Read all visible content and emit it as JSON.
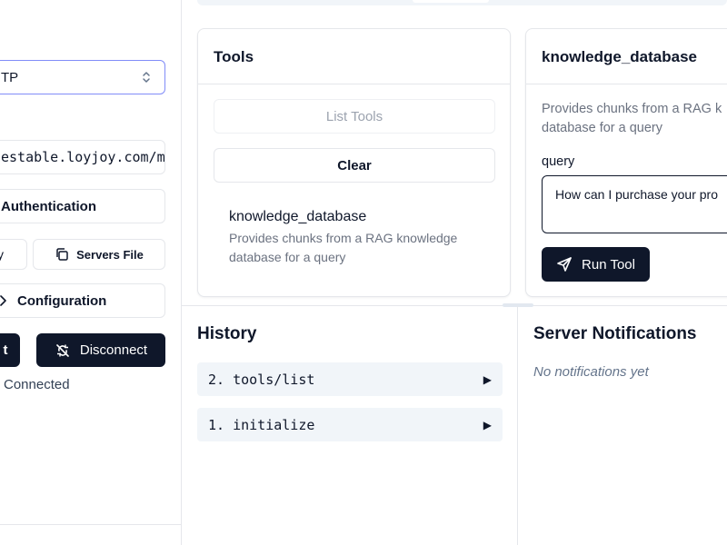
{
  "sidebar": {
    "transport_value": "TP",
    "url_value": "estable.loyjoy.com/m",
    "auth_label": "Authentication",
    "copy_label": "y",
    "servers_file_label": "Servers File",
    "config_label": "Configuration",
    "reconnect_label": "t",
    "disconnect_label": "Disconnect",
    "status_text": "Connected"
  },
  "tools_panel": {
    "title": "Tools",
    "list_tools_label": "List Tools",
    "clear_label": "Clear",
    "items": [
      {
        "name": "knowledge_database",
        "description": "Provides chunks from a RAG knowledge database for a query"
      }
    ]
  },
  "tool_detail": {
    "title": "knowledge_database",
    "description_line1": "Provides chunks from a RAG k",
    "description_line2": "database for a query",
    "param_label": "query",
    "param_value": "How can I purchase your pro",
    "run_label": "Run Tool"
  },
  "history": {
    "title": "History",
    "items": [
      {
        "label": "2. tools/list"
      },
      {
        "label": "1. initialize"
      }
    ]
  },
  "notifications": {
    "title": "Server Notifications",
    "empty_text": "No notifications yet"
  },
  "colors": {
    "primary": "#0f172a",
    "muted_text": "#6b7280",
    "focus_ring": "#818cf8",
    "row_background": "#f1f5f9"
  }
}
